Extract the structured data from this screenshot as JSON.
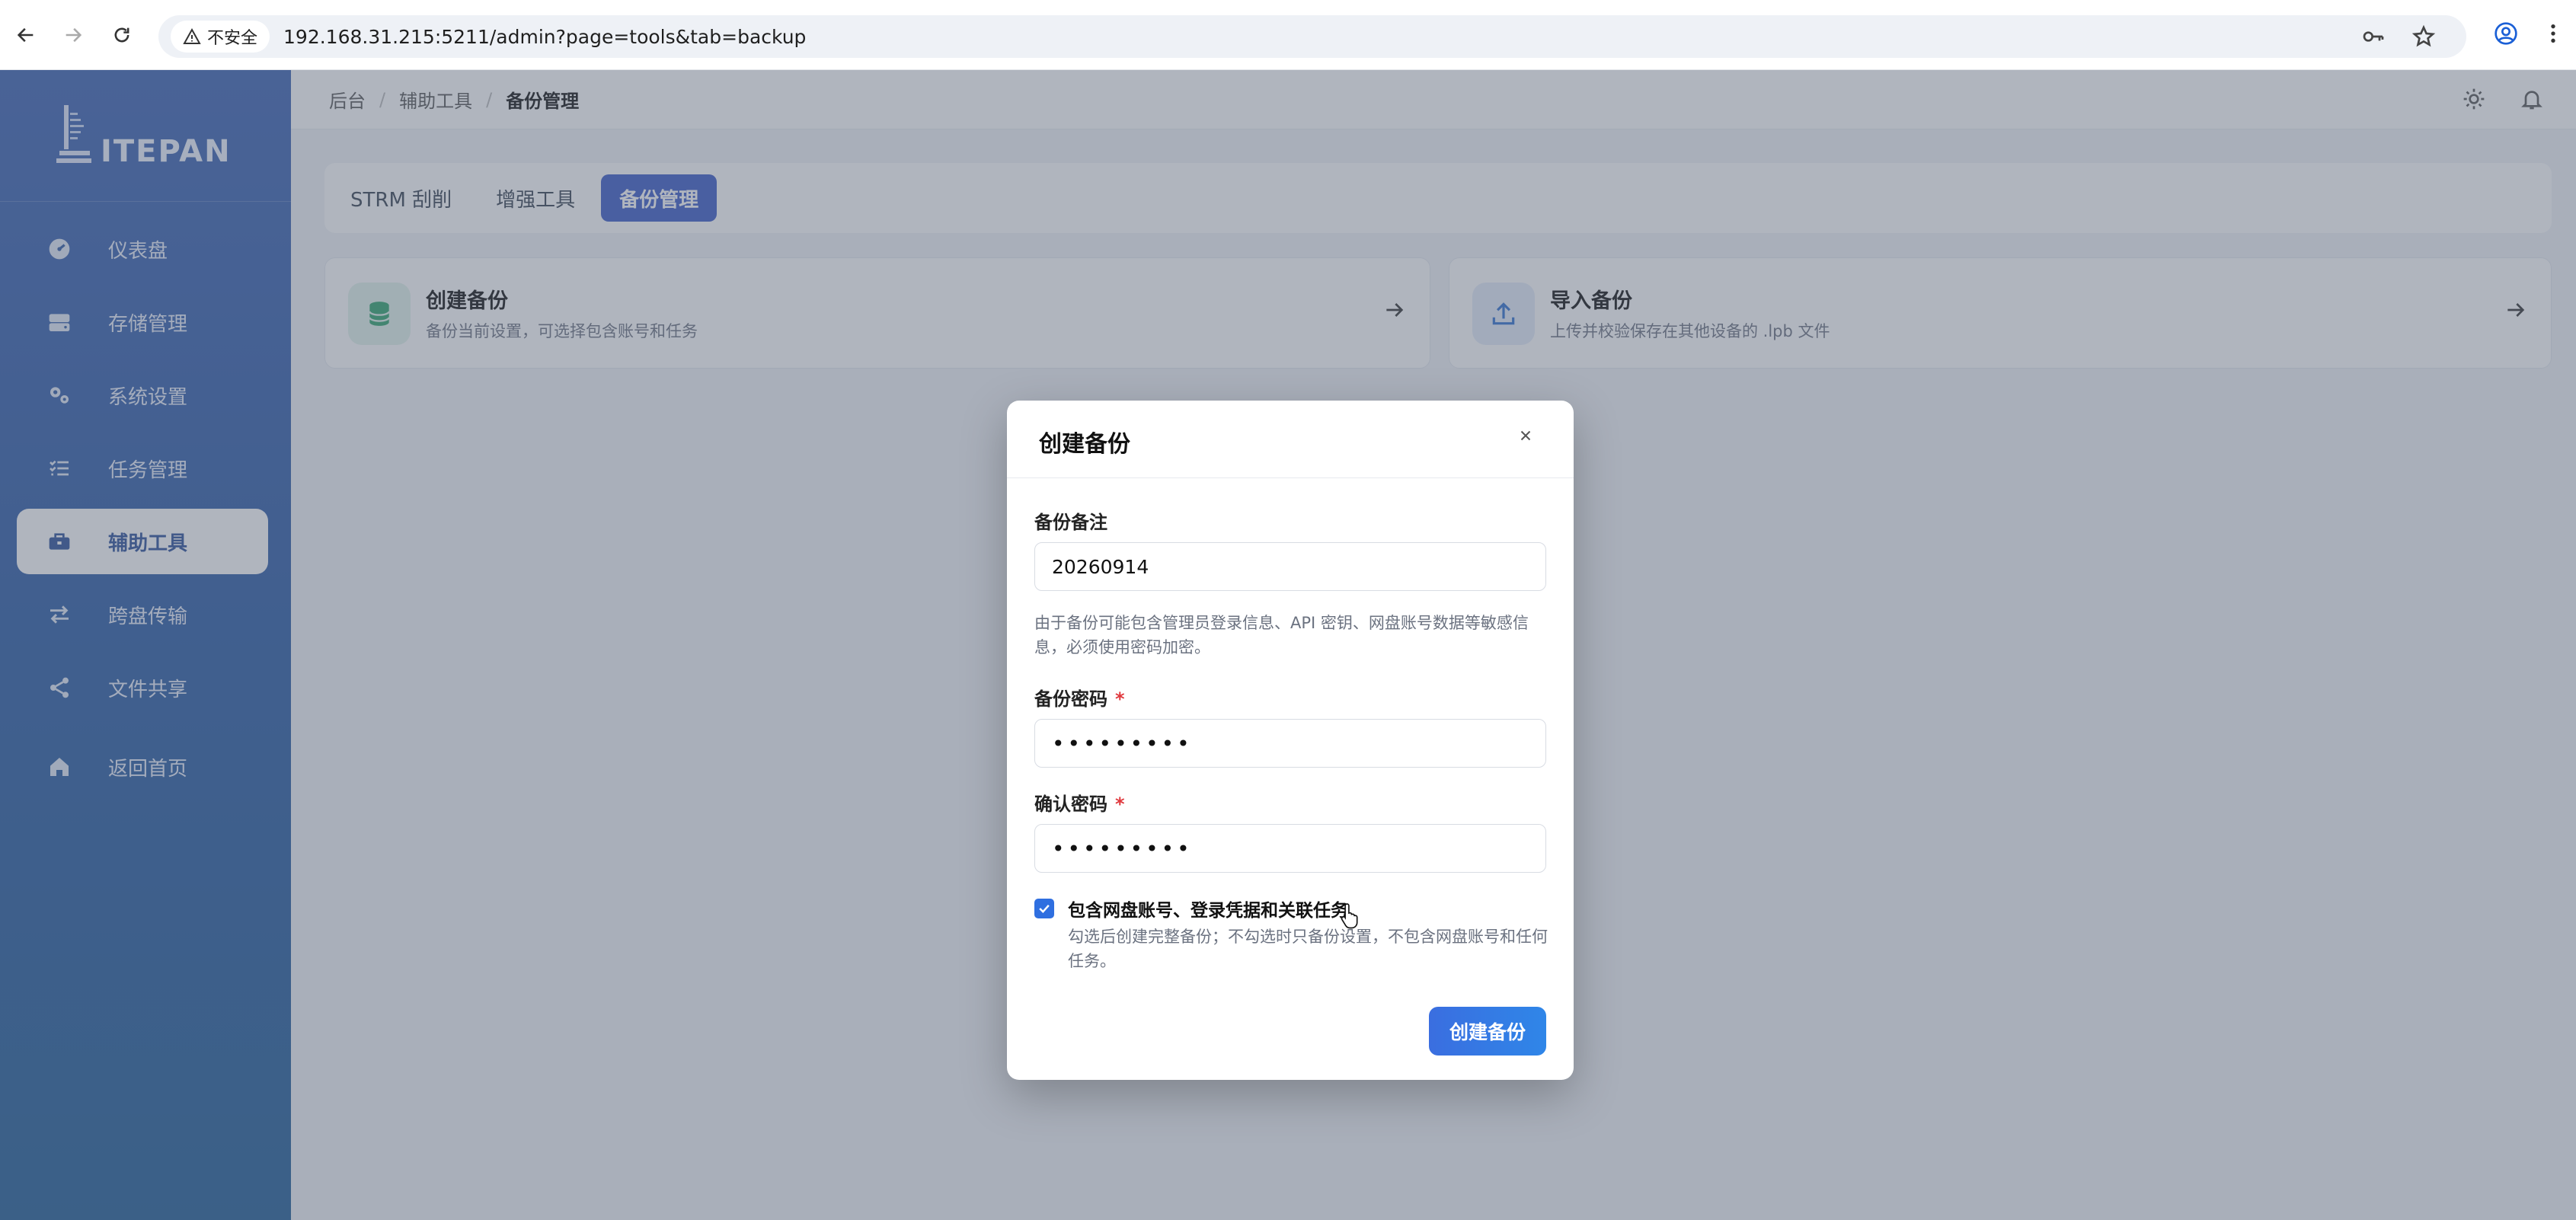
{
  "browser": {
    "security_label": "不安全",
    "url": "192.168.31.215:5211/admin?page=tools&tab=backup"
  },
  "sidebar": {
    "logo_text": "ITEPAN",
    "items": [
      {
        "label": "仪表盘",
        "icon": "dashboard-icon"
      },
      {
        "label": "存储管理",
        "icon": "storage-icon"
      },
      {
        "label": "系统设置",
        "icon": "gears-icon"
      },
      {
        "label": "任务管理",
        "icon": "task-list-icon"
      },
      {
        "label": "辅助工具",
        "icon": "toolbox-icon",
        "active": true
      },
      {
        "label": "跨盘传输",
        "icon": "transfer-icon"
      },
      {
        "label": "文件共享",
        "icon": "share-icon"
      },
      {
        "label": "返回首页",
        "icon": "home-icon"
      }
    ]
  },
  "breadcrumb": [
    "后台",
    "辅助工具",
    "备份管理"
  ],
  "tabs": [
    {
      "label": "STRM 刮削"
    },
    {
      "label": "增强工具"
    },
    {
      "label": "备份管理",
      "active": true
    }
  ],
  "cards": [
    {
      "title": "创建备份",
      "desc": "备份当前设置，可选择包含账号和任务",
      "icon": "database-icon"
    },
    {
      "title": "导入备份",
      "desc": "上传并校验保存在其他设备的 .lpb 文件",
      "icon": "upload-icon"
    }
  ],
  "modal": {
    "title": "创建备份",
    "note_label": "备份备注",
    "note_value": "20260914",
    "warning": "由于备份可能包含管理员登录信息、API 密钥、网盘账号数据等敏感信息，必须使用密码加密。",
    "password_label": "备份密码",
    "password_value": "•••••••••",
    "confirm_label": "确认密码",
    "confirm_value": "•••••••••",
    "required_mark": "*",
    "checkbox_label": "包含网盘账号、登录凭据和关联任务",
    "checkbox_checked": true,
    "checkbox_hint": "勾选后创建完整备份；不勾选时只备份设置，不包含网盘账号和任何任务。",
    "submit_label": "创建备份"
  },
  "colors": {
    "accent": "#3b5bc8",
    "sidebar_top": "#3b62b3",
    "sidebar_bottom": "#1f5c96",
    "required": "#e0393e",
    "button": "#2f6fe0"
  }
}
